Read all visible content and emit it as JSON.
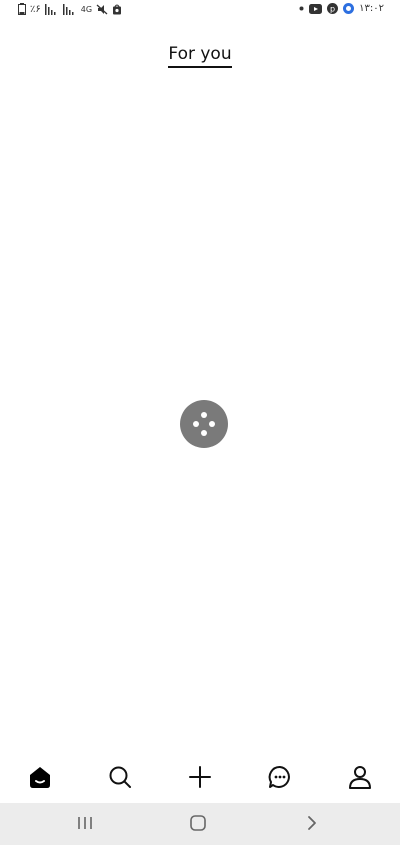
{
  "status_bar": {
    "battery_text": "٪۶",
    "network_text": "4G",
    "time": "۱۳:۰۲"
  },
  "header": {
    "tab_label": "For you"
  },
  "bottom_nav": {
    "items": [
      {
        "icon": "home-icon"
      },
      {
        "icon": "search-icon"
      },
      {
        "icon": "plus-icon"
      },
      {
        "icon": "messages-icon"
      },
      {
        "icon": "profile-icon"
      }
    ]
  },
  "system_nav": {
    "items": [
      {
        "icon": "recents-icon"
      },
      {
        "icon": "home-button-icon"
      },
      {
        "icon": "back-icon"
      }
    ]
  }
}
